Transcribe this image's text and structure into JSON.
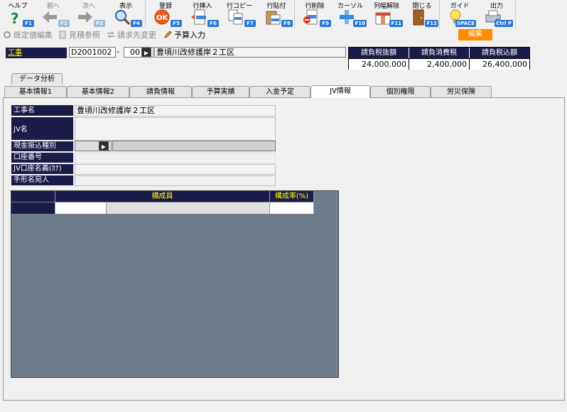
{
  "toolbar": {
    "buttons": [
      {
        "label": "ヘルプ",
        "key": "F1",
        "icon": "help-icon"
      },
      {
        "label": "前へ",
        "key": "F2",
        "icon": "arrow-left-icon"
      },
      {
        "label": "次へ",
        "key": "F3",
        "icon": "arrow-right-icon"
      },
      {
        "label": "表示",
        "key": "F4",
        "icon": "magnifier-icon"
      },
      {
        "label": "登録",
        "key": "F5",
        "icon": "ok-icon"
      },
      {
        "label": "行挿入",
        "key": "F6",
        "icon": "row-insert-icon"
      },
      {
        "label": "行コピー",
        "key": "F7",
        "icon": "row-copy-icon"
      },
      {
        "label": "行貼付",
        "key": "F8",
        "icon": "row-paste-icon"
      },
      {
        "label": "行削除",
        "key": "F9",
        "icon": "row-delete-icon"
      },
      {
        "label": "カーソル",
        "key": "F10",
        "icon": "cursor-icon"
      },
      {
        "label": "列幅解除",
        "key": "F11",
        "icon": "column-width-icon"
      },
      {
        "label": "閉じる",
        "key": "F12",
        "icon": "door-icon"
      },
      {
        "label": "ガイド",
        "key": "SPACE",
        "icon": "lightbulb-icon"
      },
      {
        "label": "出力",
        "key": "Ctrl P",
        "icon": "output-icon"
      }
    ]
  },
  "subbar": {
    "items": [
      {
        "label": "既定値編集",
        "icon": "gear-icon"
      },
      {
        "label": "見積参照",
        "icon": "document-icon"
      },
      {
        "label": "請求先変更",
        "icon": "swap-icon"
      },
      {
        "label": "予算入力",
        "icon": "pen-icon"
      }
    ],
    "mode": "編集"
  },
  "header": {
    "label": "工事",
    "code": "D2001002",
    "dash": "-",
    "branch": "00",
    "arrow": "▶",
    "name": "豊頃川改修護岸２工区"
  },
  "totals": {
    "headers": [
      "請負税抜額",
      "請負消費税",
      "請負税込額"
    ],
    "values": [
      "24,000,000",
      "2,400,000",
      "26,400,000"
    ]
  },
  "tabs_top": [
    "データ分析"
  ],
  "tabs": [
    "基本情報1",
    "基本情報2",
    "請負情報",
    "予算実績",
    "入金予定",
    "JV情報",
    "個別権限",
    "労災保険"
  ],
  "jv_form": {
    "rows": [
      {
        "label": "工事名",
        "value": "豊頃川改修護岸２工区"
      },
      {
        "label": "JV名",
        "value": ""
      },
      {
        "label": "現金振込種別",
        "value": ""
      },
      {
        "label": "口座番号",
        "value": ""
      },
      {
        "label": "JV口座名義(ｶﾅ)",
        "value": ""
      },
      {
        "label": "手形名宛人",
        "value": ""
      }
    ],
    "arrow": "▶"
  },
  "grid": {
    "headers": [
      "",
      "構成員",
      "構成率(%)"
    ]
  },
  "colors": {
    "header_navy": "#1b1b4a",
    "accent_yellow": "#ffff00",
    "mode_orange": "#ff8c00",
    "grid_bg": "#6e7d8c"
  }
}
